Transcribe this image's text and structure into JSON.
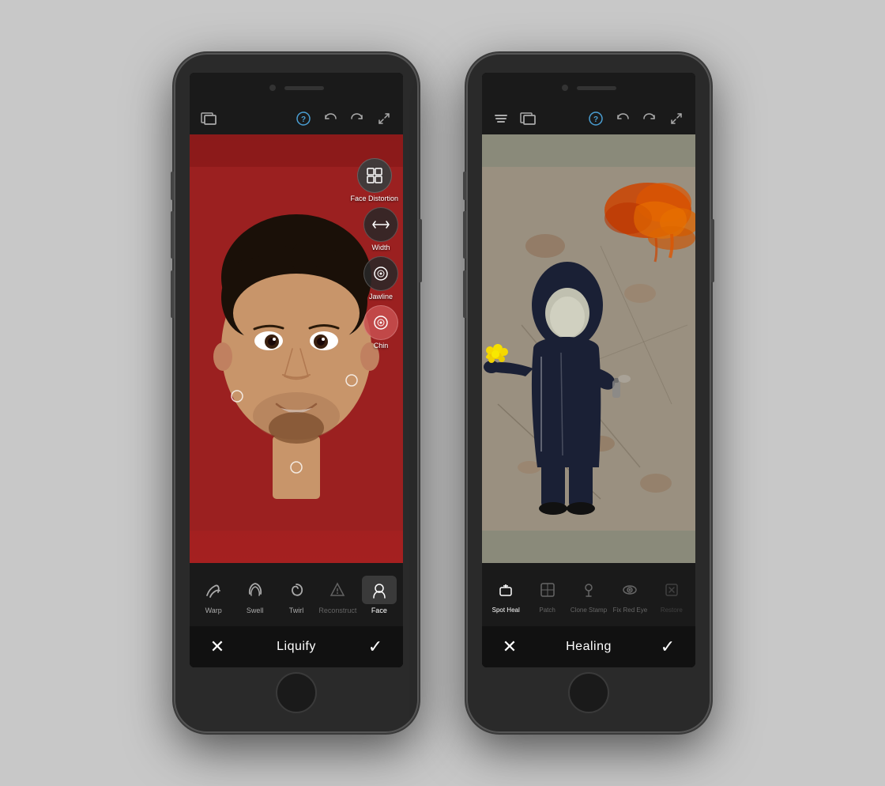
{
  "phone_left": {
    "toolbar": {
      "icons": [
        "image",
        "help",
        "undo",
        "redo",
        "expand"
      ]
    },
    "distortion_panel": {
      "items": [
        {
          "id": "face-distortion",
          "label": "Face Distortion",
          "icon": "⊞",
          "active": true
        },
        {
          "id": "width",
          "label": "Width",
          "icon": "↔",
          "active": false
        },
        {
          "id": "jawline",
          "label": "Jawline",
          "icon": "◎",
          "active": false
        },
        {
          "id": "chin",
          "label": "Chin",
          "icon": "◎",
          "active": false
        }
      ]
    },
    "tools": [
      {
        "id": "warp",
        "label": "Warp",
        "active": false
      },
      {
        "id": "swell",
        "label": "Swell",
        "active": false
      },
      {
        "id": "twirl",
        "label": "Twirl",
        "active": false
      },
      {
        "id": "reconstruct",
        "label": "Reconstruct",
        "active": false
      },
      {
        "id": "face",
        "label": "Face",
        "active": true
      }
    ],
    "action": {
      "cancel": "✕",
      "title": "Liquify",
      "confirm": "✓"
    }
  },
  "phone_right": {
    "toolbar": {
      "icons": [
        "layers",
        "image",
        "help",
        "undo",
        "redo",
        "expand"
      ]
    },
    "healing_tools": [
      {
        "id": "spot-heal",
        "label": "Spot Heal",
        "active": true
      },
      {
        "id": "patch",
        "label": "Patch",
        "active": false
      },
      {
        "id": "clone-stamp",
        "label": "Clone Stamp",
        "active": false
      },
      {
        "id": "fix-red-eye",
        "label": "Fix Red Eye",
        "active": false
      },
      {
        "id": "restore",
        "label": "Restore",
        "active": false
      }
    ],
    "action": {
      "cancel": "✕",
      "title": "Healing",
      "confirm": "✓"
    }
  },
  "colors": {
    "phone_body": "#2a2a2a",
    "screen_bg": "#000",
    "toolbar_bg": "#1a1a1a",
    "action_bg": "#111",
    "face_bg_top": "#8b1a1a",
    "face_bg_bottom": "#a52020",
    "accent_blue": "#4a9fd4"
  }
}
